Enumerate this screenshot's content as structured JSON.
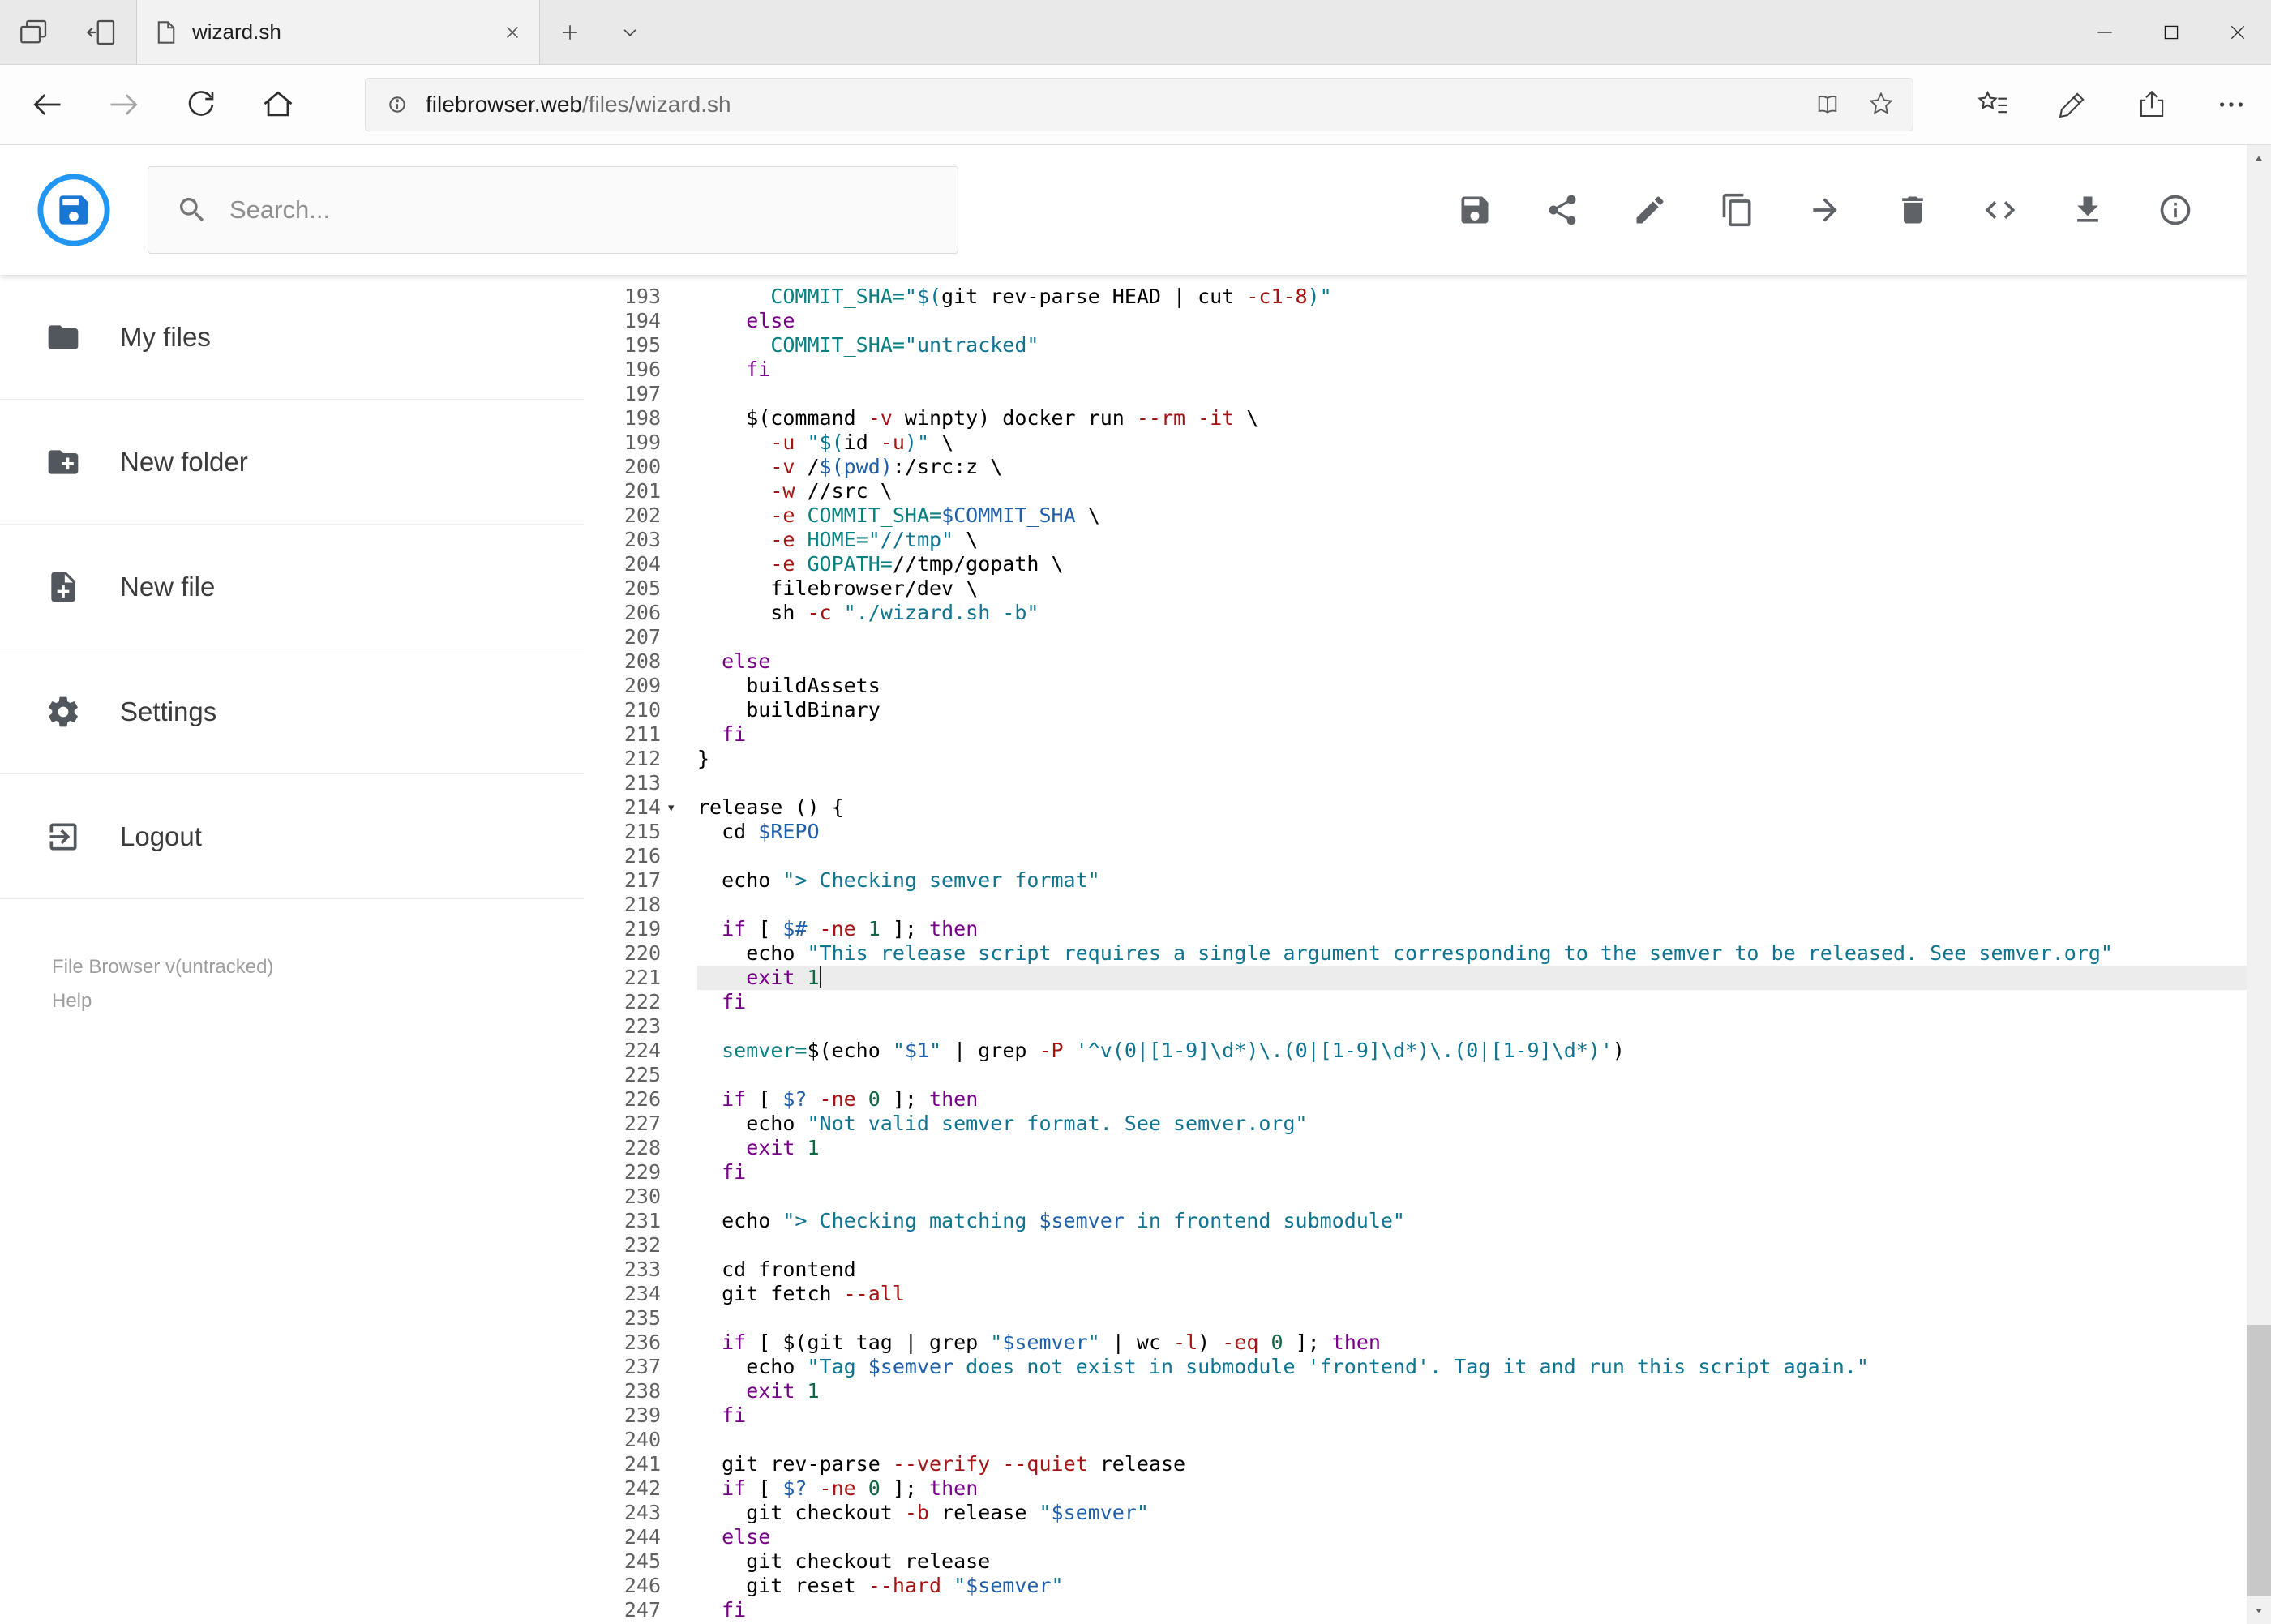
{
  "browser": {
    "tab": {
      "title": "wizard.sh"
    },
    "url": {
      "domain": "filebrowser.web",
      "path": "/files/wizard.sh"
    },
    "window_controls": [
      "minimize",
      "maximize",
      "close"
    ]
  },
  "header": {
    "search": {
      "placeholder": "Search..."
    },
    "actions": [
      {
        "name": "save"
      },
      {
        "name": "share"
      },
      {
        "name": "rename"
      },
      {
        "name": "copy"
      },
      {
        "name": "move"
      },
      {
        "name": "delete"
      },
      {
        "name": "raw-code"
      },
      {
        "name": "download"
      },
      {
        "name": "info"
      }
    ]
  },
  "sidebar": {
    "items": [
      {
        "label": "My files",
        "icon": "folder-icon"
      },
      {
        "label": "New folder",
        "icon": "new-folder-icon"
      },
      {
        "label": "New file",
        "icon": "new-file-icon"
      },
      {
        "label": "Settings",
        "icon": "settings-icon"
      },
      {
        "label": "Logout",
        "icon": "logout-icon"
      }
    ],
    "footer": {
      "version": "File Browser v(untracked)",
      "help": "Help"
    }
  },
  "editor": {
    "language": "shell",
    "active_line": 221,
    "fold_marker_line": 214,
    "lines": [
      {
        "n": 193,
        "seg": [
          [
            "",
            "      "
          ],
          [
            "def",
            "COMMIT_SHA="
          ],
          [
            "str",
            "\"$("
          ],
          [
            "",
            "git rev-parse HEAD | cut "
          ],
          [
            "opt",
            "-c1-8"
          ],
          [
            "str",
            ")\""
          ]
        ]
      },
      {
        "n": 194,
        "seg": [
          [
            "",
            "    "
          ],
          [
            "kw",
            "else"
          ]
        ]
      },
      {
        "n": 195,
        "seg": [
          [
            "",
            "      "
          ],
          [
            "def",
            "COMMIT_SHA="
          ],
          [
            "str",
            "\"untracked\""
          ]
        ]
      },
      {
        "n": 196,
        "seg": [
          [
            "",
            "    "
          ],
          [
            "kw",
            "fi"
          ]
        ]
      },
      {
        "n": 197,
        "seg": []
      },
      {
        "n": 198,
        "seg": [
          [
            "",
            "    $(command "
          ],
          [
            "opt",
            "-v"
          ],
          [
            "",
            " winpty) docker run "
          ],
          [
            "opt",
            "--rm"
          ],
          [
            "",
            " "
          ],
          [
            "opt",
            "-it"
          ],
          [
            "",
            " \\"
          ]
        ]
      },
      {
        "n": 199,
        "seg": [
          [
            "",
            "      "
          ],
          [
            "opt",
            "-u"
          ],
          [
            "",
            " "
          ],
          [
            "str",
            "\"$("
          ],
          [
            "",
            "id "
          ],
          [
            "opt",
            "-u"
          ],
          [
            "str",
            ")\""
          ],
          [
            "",
            " \\"
          ]
        ]
      },
      {
        "n": 200,
        "seg": [
          [
            "",
            "      "
          ],
          [
            "opt",
            "-v"
          ],
          [
            "",
            " /"
          ],
          [
            "var",
            "$(pwd)"
          ],
          [
            "",
            ":/src:z \\"
          ]
        ]
      },
      {
        "n": 201,
        "seg": [
          [
            "",
            "      "
          ],
          [
            "opt",
            "-w"
          ],
          [
            "",
            " //src \\"
          ]
        ]
      },
      {
        "n": 202,
        "seg": [
          [
            "",
            "      "
          ],
          [
            "opt",
            "-e"
          ],
          [
            "",
            " "
          ],
          [
            "def",
            "COMMIT_SHA="
          ],
          [
            "var",
            "$COMMIT_SHA"
          ],
          [
            "",
            " \\"
          ]
        ]
      },
      {
        "n": 203,
        "seg": [
          [
            "",
            "      "
          ],
          [
            "opt",
            "-e"
          ],
          [
            "",
            " "
          ],
          [
            "def",
            "HOME="
          ],
          [
            "str",
            "\"//tmp\""
          ],
          [
            "",
            " \\"
          ]
        ]
      },
      {
        "n": 204,
        "seg": [
          [
            "",
            "      "
          ],
          [
            "opt",
            "-e"
          ],
          [
            "",
            " "
          ],
          [
            "def",
            "GOPATH="
          ],
          [
            "",
            "//tmp/gopath \\"
          ]
        ]
      },
      {
        "n": 205,
        "seg": [
          [
            "",
            "      filebrowser/dev \\"
          ]
        ]
      },
      {
        "n": 206,
        "seg": [
          [
            "",
            "      sh "
          ],
          [
            "opt",
            "-c"
          ],
          [
            "",
            " "
          ],
          [
            "str",
            "\"./wizard.sh -b\""
          ]
        ]
      },
      {
        "n": 207,
        "seg": []
      },
      {
        "n": 208,
        "seg": [
          [
            "",
            "  "
          ],
          [
            "kw",
            "else"
          ]
        ]
      },
      {
        "n": 209,
        "seg": [
          [
            "",
            "    buildAssets"
          ]
        ]
      },
      {
        "n": 210,
        "seg": [
          [
            "",
            "    buildBinary"
          ]
        ]
      },
      {
        "n": 211,
        "seg": [
          [
            "",
            "  "
          ],
          [
            "kw",
            "fi"
          ]
        ]
      },
      {
        "n": 212,
        "seg": [
          [
            "",
            "}"
          ]
        ]
      },
      {
        "n": 213,
        "seg": []
      },
      {
        "n": 214,
        "seg": [
          [
            "",
            "release () {"
          ]
        ]
      },
      {
        "n": 215,
        "seg": [
          [
            "",
            "  cd "
          ],
          [
            "var",
            "$REPO"
          ]
        ]
      },
      {
        "n": 216,
        "seg": []
      },
      {
        "n": 217,
        "seg": [
          [
            "",
            "  echo "
          ],
          [
            "str",
            "\"> Checking semver format\""
          ]
        ]
      },
      {
        "n": 218,
        "seg": []
      },
      {
        "n": 219,
        "seg": [
          [
            "",
            "  "
          ],
          [
            "kw",
            "if"
          ],
          [
            "",
            " [ "
          ],
          [
            "var",
            "$#"
          ],
          [
            "",
            " "
          ],
          [
            "opt",
            "-ne"
          ],
          [
            "",
            " "
          ],
          [
            "num",
            "1"
          ],
          [
            "",
            " ]; "
          ],
          [
            "kw",
            "then"
          ]
        ]
      },
      {
        "n": 220,
        "seg": [
          [
            "",
            "    echo "
          ],
          [
            "str",
            "\"This release script requires a single argument corresponding to the semver to be released. See semver.org\""
          ]
        ]
      },
      {
        "n": 221,
        "seg": [
          [
            "",
            "    "
          ],
          [
            "kw",
            "exit"
          ],
          [
            "",
            " "
          ],
          [
            "num",
            "1"
          ]
        ]
      },
      {
        "n": 222,
        "seg": [
          [
            "",
            "  "
          ],
          [
            "kw",
            "fi"
          ]
        ]
      },
      {
        "n": 223,
        "seg": []
      },
      {
        "n": 224,
        "seg": [
          [
            "",
            "  "
          ],
          [
            "def",
            "semver="
          ],
          [
            "",
            "$(echo "
          ],
          [
            "str",
            "\""
          ],
          [
            "var",
            "$1"
          ],
          [
            "str",
            "\""
          ],
          [
            "",
            " | grep "
          ],
          [
            "opt",
            "-P"
          ],
          [
            "",
            " "
          ],
          [
            "str",
            "'^v(0|[1-9]\\d*)\\.(0|[1-9]\\d*)\\.(0|[1-9]\\d*)'"
          ],
          [
            "",
            ")"
          ]
        ]
      },
      {
        "n": 225,
        "seg": []
      },
      {
        "n": 226,
        "seg": [
          [
            "",
            "  "
          ],
          [
            "kw",
            "if"
          ],
          [
            "",
            " [ "
          ],
          [
            "var",
            "$?"
          ],
          [
            "",
            " "
          ],
          [
            "opt",
            "-ne"
          ],
          [
            "",
            " "
          ],
          [
            "num",
            "0"
          ],
          [
            "",
            " ]; "
          ],
          [
            "kw",
            "then"
          ]
        ]
      },
      {
        "n": 227,
        "seg": [
          [
            "",
            "    echo "
          ],
          [
            "str",
            "\"Not valid semver format. See semver.org\""
          ]
        ]
      },
      {
        "n": 228,
        "seg": [
          [
            "",
            "    "
          ],
          [
            "kw",
            "exit"
          ],
          [
            "",
            " "
          ],
          [
            "num",
            "1"
          ]
        ]
      },
      {
        "n": 229,
        "seg": [
          [
            "",
            "  "
          ],
          [
            "kw",
            "fi"
          ]
        ]
      },
      {
        "n": 230,
        "seg": []
      },
      {
        "n": 231,
        "seg": [
          [
            "",
            "  echo "
          ],
          [
            "str",
            "\"> Checking matching "
          ],
          [
            "var",
            "$semver"
          ],
          [
            "str",
            " in frontend submodule\""
          ]
        ]
      },
      {
        "n": 232,
        "seg": []
      },
      {
        "n": 233,
        "seg": [
          [
            "",
            "  cd frontend"
          ]
        ]
      },
      {
        "n": 234,
        "seg": [
          [
            "",
            "  git fetch "
          ],
          [
            "opt",
            "--all"
          ]
        ]
      },
      {
        "n": 235,
        "seg": []
      },
      {
        "n": 236,
        "seg": [
          [
            "",
            "  "
          ],
          [
            "kw",
            "if"
          ],
          [
            "",
            " [ $(git tag | grep "
          ],
          [
            "str",
            "\""
          ],
          [
            "var",
            "$semver"
          ],
          [
            "str",
            "\""
          ],
          [
            "",
            " | wc "
          ],
          [
            "opt",
            "-l"
          ],
          [
            "",
            ") "
          ],
          [
            "opt",
            "-eq"
          ],
          [
            "",
            " "
          ],
          [
            "num",
            "0"
          ],
          [
            "",
            " ]; "
          ],
          [
            "kw",
            "then"
          ]
        ]
      },
      {
        "n": 237,
        "seg": [
          [
            "",
            "    echo "
          ],
          [
            "str",
            "\"Tag "
          ],
          [
            "var",
            "$semver"
          ],
          [
            "str",
            " does not exist in submodule 'frontend'. Tag it and run this script again.\""
          ]
        ]
      },
      {
        "n": 238,
        "seg": [
          [
            "",
            "    "
          ],
          [
            "kw",
            "exit"
          ],
          [
            "",
            " "
          ],
          [
            "num",
            "1"
          ]
        ]
      },
      {
        "n": 239,
        "seg": [
          [
            "",
            "  "
          ],
          [
            "kw",
            "fi"
          ]
        ]
      },
      {
        "n": 240,
        "seg": []
      },
      {
        "n": 241,
        "seg": [
          [
            "",
            "  git rev-parse "
          ],
          [
            "opt",
            "--verify"
          ],
          [
            "",
            " "
          ],
          [
            "opt",
            "--quiet"
          ],
          [
            "",
            " release"
          ]
        ]
      },
      {
        "n": 242,
        "seg": [
          [
            "",
            "  "
          ],
          [
            "kw",
            "if"
          ],
          [
            "",
            " [ "
          ],
          [
            "var",
            "$?"
          ],
          [
            "",
            " "
          ],
          [
            "opt",
            "-ne"
          ],
          [
            "",
            " "
          ],
          [
            "num",
            "0"
          ],
          [
            "",
            " ]; "
          ],
          [
            "kw",
            "then"
          ]
        ]
      },
      {
        "n": 243,
        "seg": [
          [
            "",
            "    git checkout "
          ],
          [
            "opt",
            "-b"
          ],
          [
            "",
            " release "
          ],
          [
            "str",
            "\""
          ],
          [
            "var",
            "$semver"
          ],
          [
            "str",
            "\""
          ]
        ]
      },
      {
        "n": 244,
        "seg": [
          [
            "",
            "  "
          ],
          [
            "kw",
            "else"
          ]
        ]
      },
      {
        "n": 245,
        "seg": [
          [
            "",
            "    git checkout release"
          ]
        ]
      },
      {
        "n": 246,
        "seg": [
          [
            "",
            "    git reset "
          ],
          [
            "opt",
            "--hard"
          ],
          [
            "",
            " "
          ],
          [
            "str",
            "\""
          ],
          [
            "var",
            "$semver"
          ],
          [
            "str",
            "\""
          ]
        ]
      },
      {
        "n": 247,
        "seg": [
          [
            "",
            "  "
          ],
          [
            "kw",
            "fi"
          ]
        ]
      }
    ]
  },
  "colors": {
    "accent": "#2196f3",
    "active_line_bg": "#ececec",
    "token_keyword": "#770088",
    "token_string": "#0e7490",
    "token_definition": "#0a7f7f",
    "token_variable": "#1f5fa8",
    "token_option": "#a31515",
    "token_number": "#116644"
  }
}
